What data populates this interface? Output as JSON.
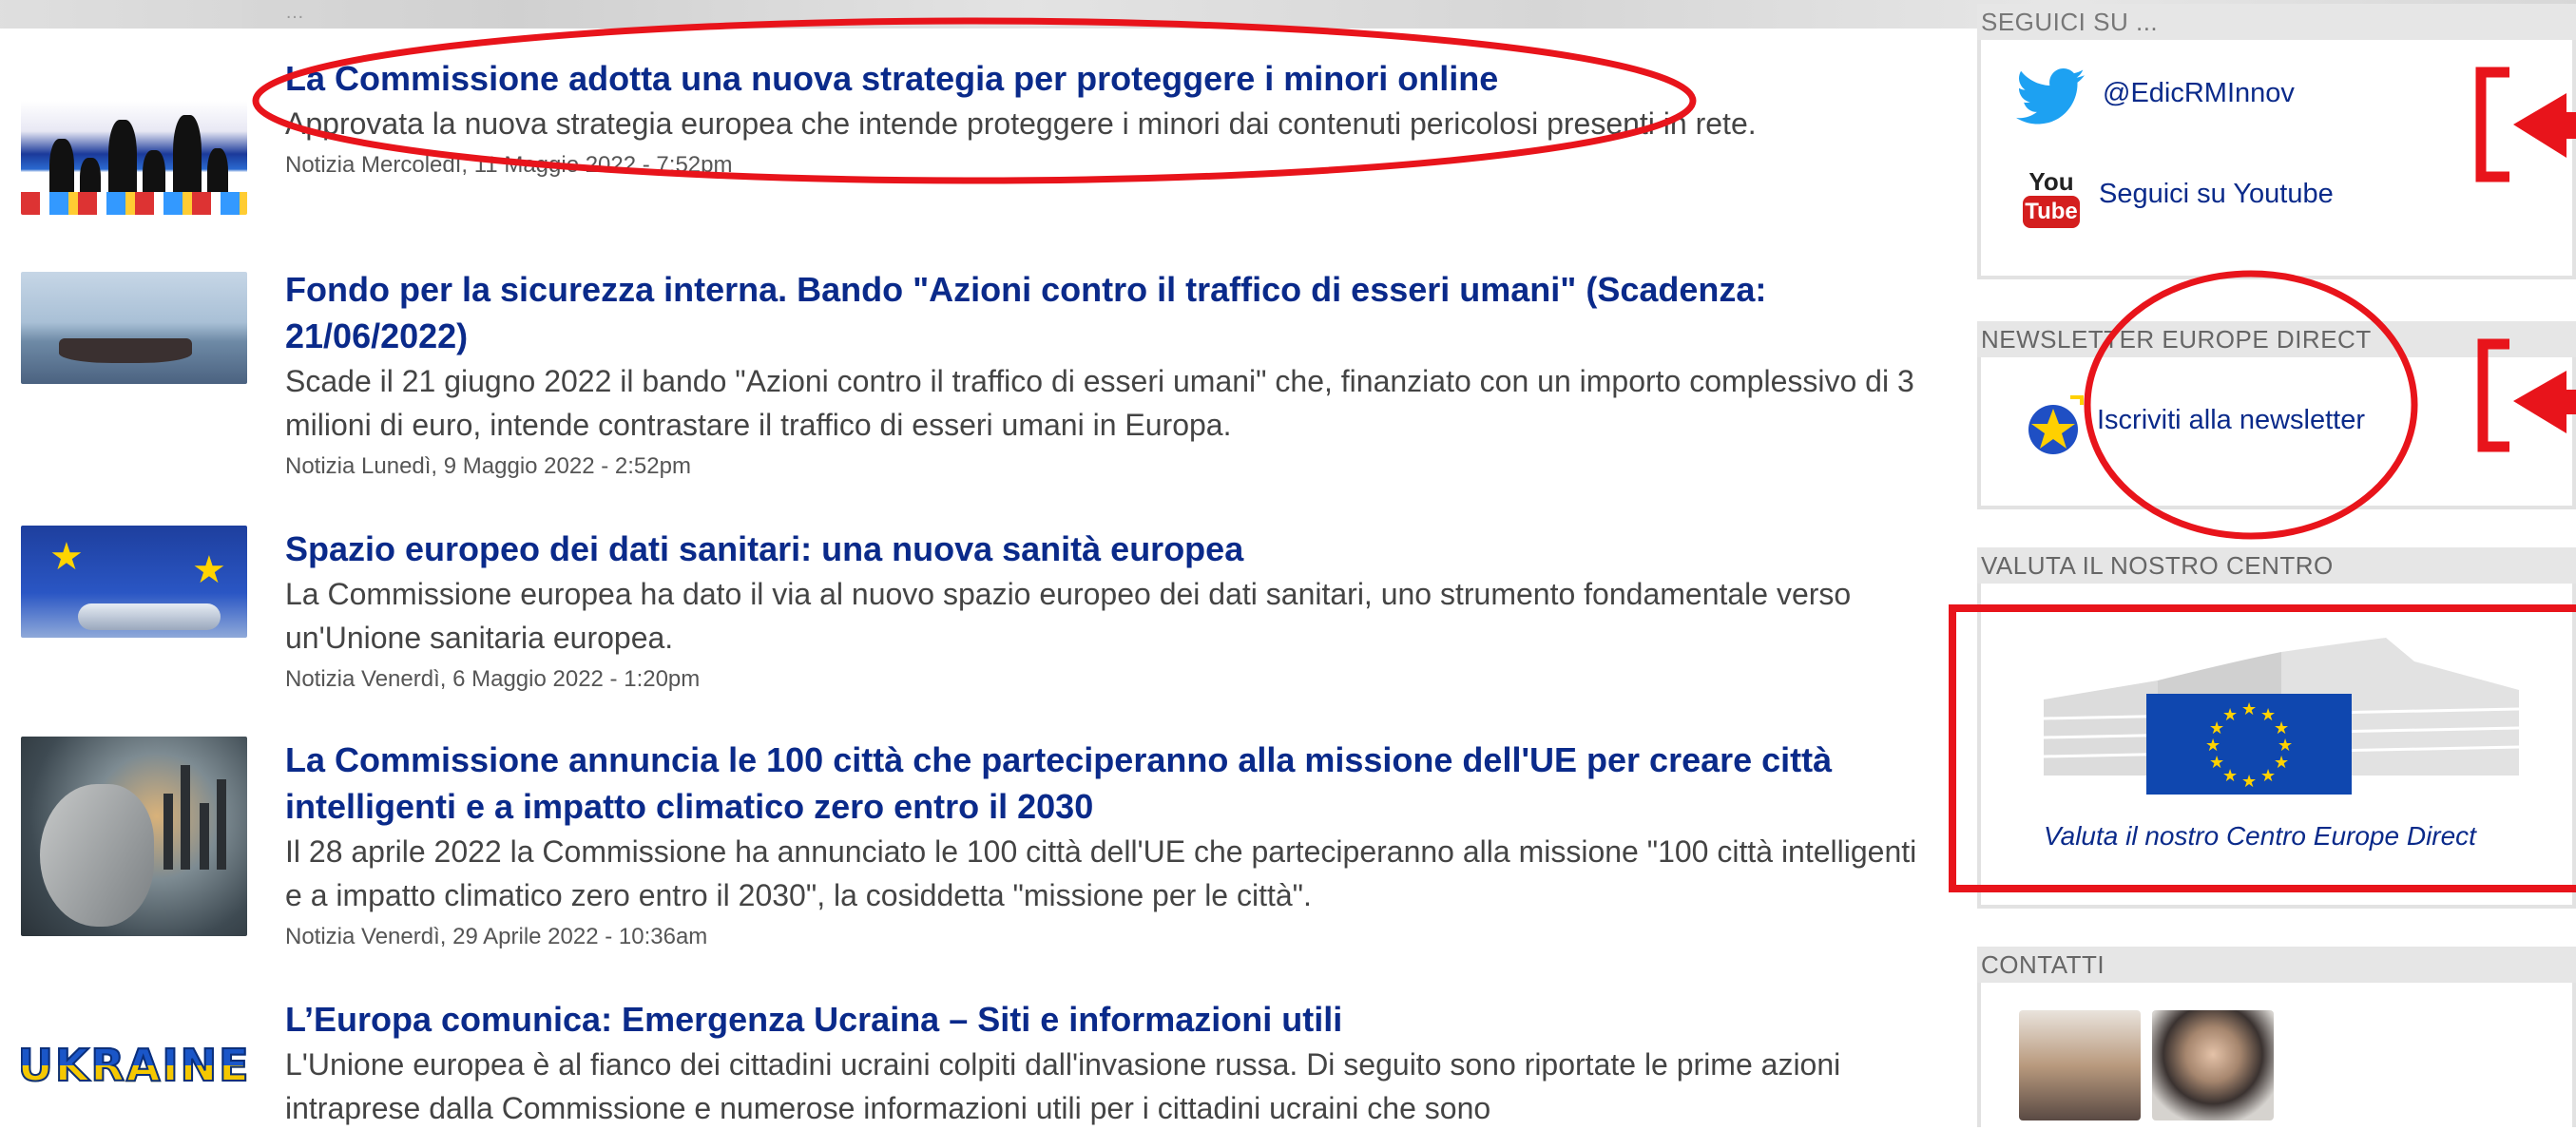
{
  "colors": {
    "link": "#0a2a8a",
    "summary": "#444444",
    "meta": "#555555",
    "sidebar_header_bg": "#e6e6e6",
    "annotation_red": "#e8141b"
  },
  "news": [
    {
      "title": "La Commissione adotta una nuova strategia per proteggere i minori online",
      "summary": "Approvata la nuova strategia europea che intende proteggere i minori dai contenuti pericolosi presenti in rete.",
      "meta": "Notizia Mercoledì, 11 Maggio 2022 - 7:52pm"
    },
    {
      "title": "Fondo per la sicurezza interna. Bando \"Azioni contro il traffico di esseri umani\" (Scadenza: 21/06/2022)",
      "summary": "Scade il 21 giugno 2022 il bando \"Azioni contro il traffico di esseri umani\" che, finanziato con un importo complessivo di 3 milioni di euro, intende contrastare il traffico di esseri umani in Europa.",
      "meta": "Notizia Lunedì, 9 Maggio 2022 - 2:52pm"
    },
    {
      "title": "Spazio europeo dei dati sanitari: una nuova sanità europea",
      "summary": "La Commissione europea ha dato il via al nuovo spazio europeo dei dati sanitari, uno strumento fondamentale verso un'Unione sanitaria europea.",
      "meta": "Notizia Venerdì, 6 Maggio 2022 - 1:20pm"
    },
    {
      "title": "La Commissione annuncia le 100 città che parteciperanno alla missione dell'UE per creare città intelligenti e a impatto climatico zero entro il 2030",
      "summary": "Il 28 aprile 2022 la Commissione ha annunciato le 100 città dell'UE che parteciperanno alla missione \"100 città intelligenti e a impatto climatico zero entro il 2030\", la cosiddetta \"missione per le città\".",
      "meta": "Notizia Venerdì, 29 Aprile 2022 - 10:36am"
    },
    {
      "title": "L’Europa comunica: Emergenza Ucraina – Siti e informazioni utili",
      "summary": "L'Unione europea è al fianco dei cittadini ucraini colpiti dall'invasione russa. Di seguito sono riportate le prime azioni intraprese dalla Commissione e numerose informazioni utili per i cittadini ucraini che sono",
      "meta": "",
      "thumb_text": "UKRAINE"
    }
  ],
  "sidebar": {
    "follow": {
      "header": "SEGUICI SU ...",
      "twitter": "@EdicRMInnov",
      "youtube_icon_top": "You",
      "youtube_icon_bottom": "Tube",
      "youtube": "Seguici su Youtube"
    },
    "newsletter": {
      "header": "NEWSLETTER EUROPE DIRECT",
      "link": "Iscriviti alla newsletter"
    },
    "rate": {
      "header": "VALUTA IL NOSTRO CENTRO",
      "caption": "Valuta il nostro Centro Europe Direct"
    },
    "contacts": {
      "header": "CONTATTI"
    }
  }
}
